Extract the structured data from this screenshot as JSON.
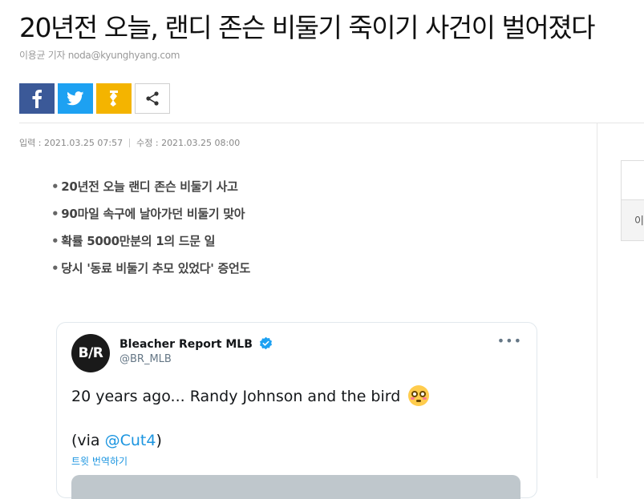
{
  "article": {
    "headline": "20년전 오늘, 랜디 존슨 비둘기 죽이기 사건이 벌어졌다",
    "byline": "이용균 기자 noda@kyunghyang.com",
    "published_label": "입력 : 2021.03.25 07:57",
    "updated_label": "수정 : 2021.03.25 08:00",
    "summary": [
      "20년전 오늘 랜디 존슨 비둘기 사고",
      "90마일 속구에 날아가던 비둘기 맞아",
      "확률 5000만분의 1의 드문 일",
      "당시 '동료 비둘기 추모 있었다' 증언도"
    ],
    "bullet": "•"
  },
  "share": {
    "icons": [
      "facebook-icon",
      "twitter-icon",
      "kakaostory-icon",
      "share-icon"
    ],
    "colors": {
      "facebook": "#3b5998",
      "twitter": "#1da1f2",
      "kakaostory": "#f4b400"
    }
  },
  "tweet": {
    "avatar_text": "B/R",
    "account_name": "Bleacher Report MLB",
    "handle": "@BR_MLB",
    "more": "•••",
    "text": "20 years ago... Randy Johnson and the bird",
    "via_prefix": "(via ",
    "via_mention": "@Cut4",
    "via_suffix": ")",
    "translate": "트윗 번역하기",
    "emoji": "flushed-face-emoji"
  },
  "sidebar": {
    "box_label": "이"
  }
}
